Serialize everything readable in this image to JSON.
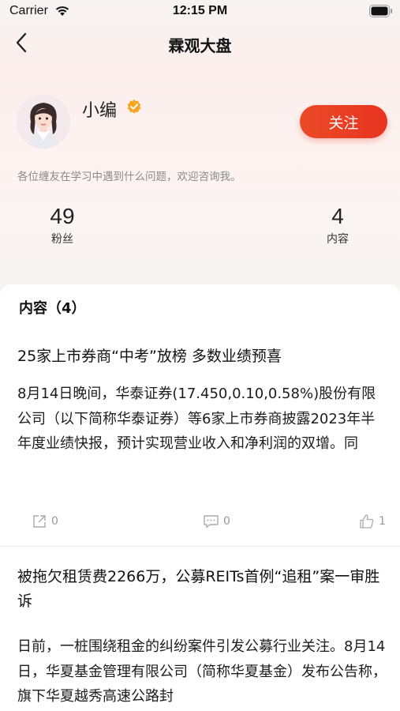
{
  "status_bar": {
    "carrier": "Carrier",
    "time": "12:15 PM"
  },
  "nav": {
    "title": "霖观大盘",
    "back_icon": "chevron-left-icon"
  },
  "profile": {
    "name": "小编",
    "verified_icon": "verified-badge-icon",
    "follow_label": "关注",
    "bio": "各位缠友在学习中遇到什么问题，欢迎咨询我。",
    "stats": {
      "fans_count": "49",
      "fans_label": "粉丝",
      "content_count": "4",
      "content_label": "内容"
    }
  },
  "content_section": {
    "title": "内容（4）",
    "articles": [
      {
        "title": "25家上市券商“中考”放榜 多数业绩预喜",
        "body": "8月14日晚间，华泰证券(17.450,0.10,0.58%)股份有限公司（以下简称华泰证券）等6家上市券商披露2023年半年度业绩快报，预计实现营业收入和净利润的双增。同",
        "shares": "0",
        "comments": "0",
        "likes": "1"
      },
      {
        "title": "被拖欠租赁费2266万，公募REITs首例“追租”案一审胜诉",
        "body": "日前，一桩围绕租金的纠纷案件引发公募行业关注。8月14日，华夏基金管理有限公司（简称华夏基金）发布公告称，旗下华夏越秀高速公路封"
      }
    ]
  },
  "colors": {
    "accent": "#e9381f",
    "verified": "#f5a623",
    "muted_text": "#8a8a8a"
  }
}
